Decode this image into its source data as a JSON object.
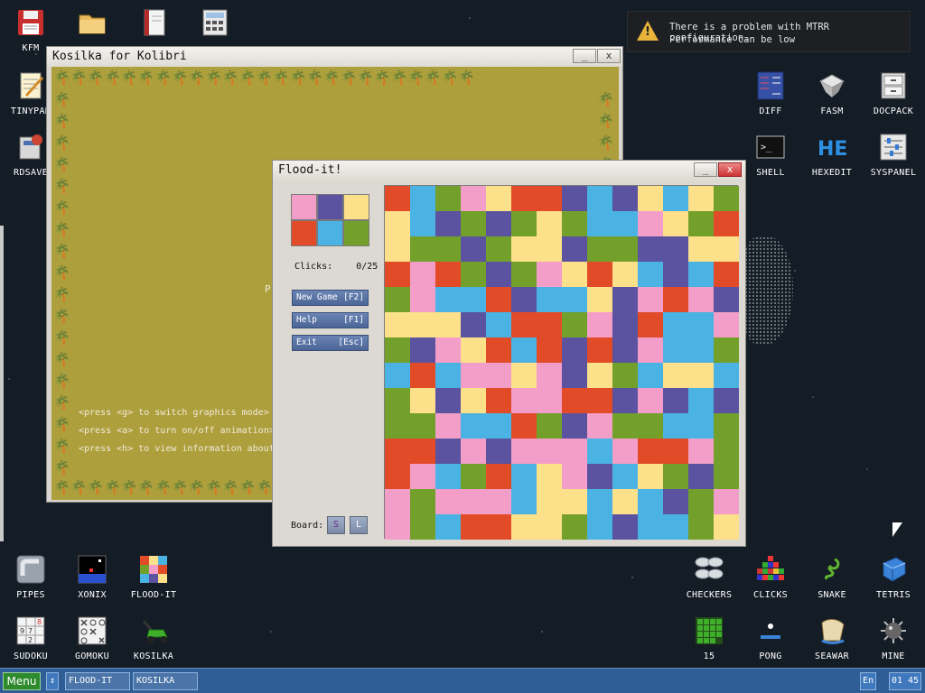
{
  "desktop": {
    "icons_left_top": [
      {
        "label": "KFM",
        "icon": "floppy-disk-icon"
      },
      {
        "label": "",
        "icon": "folder-icon"
      },
      {
        "label": "",
        "icon": "notebook-icon"
      },
      {
        "label": "",
        "icon": "calculator-icon"
      }
    ],
    "icons_left_column": [
      {
        "label": "TINYPAD",
        "icon": "notepad-icon"
      },
      {
        "label": "RDSAVE",
        "icon": "disk-save-icon"
      }
    ],
    "icons_right": [
      {
        "label": "DIFF",
        "icon": "diff-icon"
      },
      {
        "label": "FASM",
        "icon": "fasm-icon"
      },
      {
        "label": "DOCPACK",
        "icon": "docpack-icon"
      },
      {
        "label": "SHELL",
        "icon": "shell-icon"
      },
      {
        "label": "HEXEDIT",
        "icon": "hexedit-icon"
      },
      {
        "label": "SYSPANEL",
        "icon": "syspanel-icon"
      }
    ],
    "icons_bottom_left": [
      {
        "label": "PIPES",
        "icon": "pipes-icon"
      },
      {
        "label": "XONIX",
        "icon": "xonix-icon"
      },
      {
        "label": "FLOOD-IT",
        "icon": "flood-it-icon"
      },
      {
        "label": "SUDOKU",
        "icon": "sudoku-icon"
      },
      {
        "label": "GOMOKU",
        "icon": "gomoku-icon"
      },
      {
        "label": "KOSILKA",
        "icon": "lawnmower-icon"
      }
    ],
    "icons_bottom_right": [
      {
        "label": "CHECKERS",
        "icon": "checkers-icon"
      },
      {
        "label": "CLICKS",
        "icon": "clicks-icon"
      },
      {
        "label": "SNAKE",
        "icon": "snake-icon"
      },
      {
        "label": "TETRIS",
        "icon": "tetris-icon"
      },
      {
        "label": "15",
        "icon": "fifteen-puzzle-icon"
      },
      {
        "label": "PONG",
        "icon": "pong-icon"
      },
      {
        "label": "SEAWAR",
        "icon": "seawar-icon"
      },
      {
        "label": "MINE",
        "icon": "mine-icon"
      }
    ]
  },
  "notification": {
    "line1": "There is a problem with MTRR configuration.",
    "line2": "Performance can be low",
    "icon": "warning-icon",
    "color": "#e8b43a"
  },
  "kosilka": {
    "title": "Kosilka for Kolibri",
    "minimize": "_",
    "close": "x",
    "hints": [
      "<press <g> to switch graphics mode>",
      "<press <a> to turn on/off animation>",
      "<press <h> to view information about"
    ],
    "partial_char": "P",
    "field_color": "#ad9f3c"
  },
  "flood": {
    "title": "Flood-it!",
    "minimize": "_",
    "close": "x",
    "palette": [
      "#f39ec8",
      "#5b539f",
      "#fde08a",
      "#e24b27",
      "#4ab3e3",
      "#72a02a"
    ],
    "clicks_label": "Clicks:",
    "clicks_value": "0/25",
    "buttons": [
      {
        "label": "New Game",
        "key": "[F2]"
      },
      {
        "label": "Help",
        "key": "[F1]"
      },
      {
        "label": "Exit",
        "key": "[Esc]"
      }
    ],
    "board_label": "Board:",
    "board_small": "S",
    "board_large": "L",
    "grid": [
      "RBGPYRRUBUYBYG",
      "YBUGUGYGBBPYGR",
      "YGGUGYYUGGUUYY",
      "RPRGUGPYRYBUBR",
      "GPBBRUBBYUPRPU",
      "YYYUBRRGPURBBP",
      "GUPYRBRURUPBBG",
      "BRBPPYPUYGBYYB",
      "GYUYRPPRRUPUBU",
      "GGPBBRGUPGGBBG",
      "RRUPUPPPBPRRPG",
      "RPBGRBYPUBYGUG",
      "PGPPPBYYBYBUGP",
      "PGBRRYYGBUBBGY"
    ]
  },
  "taskbar": {
    "menu_label": "Menu",
    "switch_icon": "↕",
    "tasks": [
      "FLOOD-IT",
      "KOSILKA"
    ],
    "lang": "En",
    "time": "01 45"
  }
}
